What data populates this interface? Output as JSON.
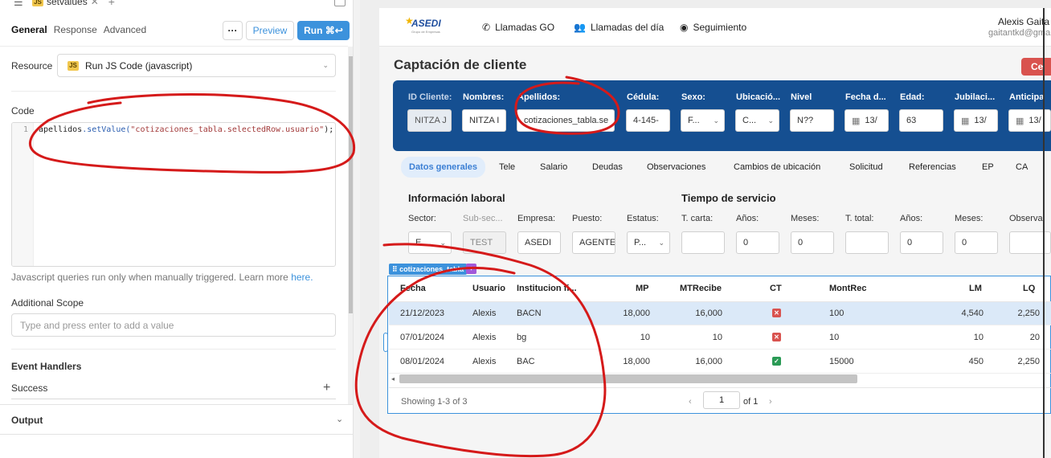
{
  "editor": {
    "query_tab": "setvalues",
    "query_badge": "JS",
    "tabs": [
      "General",
      "Response",
      "Advanced"
    ],
    "more_label": "···",
    "preview_label": "Preview",
    "run_label": "Run ⌘↩",
    "resource_label": "Resource",
    "resource_value": "Run JS Code (javascript)",
    "code_label": "Code",
    "code_line_number": "1",
    "code_obj": "apellidos",
    "code_fn": ".setValue(",
    "code_str": "\"cotizaciones_tabla.selectedRow.usuario\"",
    "code_end": ");",
    "hint_text": "Javascript queries run only when manually triggered. Learn more ",
    "hint_link": "here.",
    "additional_scope_label": "Additional Scope",
    "additional_scope_placeholder": "Type and press enter to add a value",
    "event_handlers_label": "Event Handlers",
    "success_label": "Success",
    "output_label": "Output"
  },
  "app": {
    "logo_text": "ASEDI",
    "logo_sub": "Grupo de Empresas",
    "nav": [
      "Llamadas GO",
      "Llamadas del día",
      "Seguimiento"
    ],
    "user_name": "Alexis Gaita",
    "user_email": "gaitantkd@gmail",
    "page_title": "Captación de cliente",
    "red_button": "Ce",
    "fields": [
      {
        "label": "ID Cliente:",
        "value": "NITZA J"
      },
      {
        "label": "Nombres:",
        "value": "NITZA I"
      },
      {
        "label": "Apellidos:",
        "value": "cotizaciones_tabla.se"
      },
      {
        "label": "Cédula:",
        "value": "4-145-"
      },
      {
        "label": "Sexo:",
        "value": "F..."
      },
      {
        "label": "Ubicació...",
        "value": "C..."
      },
      {
        "label": "Nivel",
        "value": "N??"
      },
      {
        "label": "Fecha d...",
        "value": "13/"
      },
      {
        "label": "Edad:",
        "value": "63"
      },
      {
        "label": "Jubilaci...",
        "value": "13/"
      },
      {
        "label": "Anticipa",
        "value": "13/"
      }
    ],
    "tabs": [
      "Datos generales",
      "Tele",
      "Salario",
      "Deudas",
      "Observaciones",
      "Cambios de ubicación",
      "Solicitud",
      "Referencias",
      "EP",
      "CA"
    ],
    "info_laboral_title": "Información laboral",
    "tiempo_servicio_title": "Tiempo de servicio",
    "labor_fields": [
      {
        "label": "Sector:",
        "value": "E ..."
      },
      {
        "label": "Sub-sec...",
        "value": "TEST"
      },
      {
        "label": "Empresa:",
        "value": "ASEDI"
      },
      {
        "label": "Puesto:",
        "value": "AGENTE"
      },
      {
        "label": "Estatus:",
        "value": "P..."
      },
      {
        "label": "T. carta:",
        "value": ""
      },
      {
        "label": "Años:",
        "value": "0"
      },
      {
        "label": "Meses:",
        "value": "0"
      },
      {
        "label": "T. total:",
        "value": ""
      },
      {
        "label": "Años:",
        "value": "0"
      },
      {
        "label": "Meses:",
        "value": "0"
      },
      {
        "label": "Observa",
        "value": ""
      }
    ],
    "table_tag": "cotizaciones_tabla",
    "table": {
      "columns": [
        "Fecha",
        "Usuario",
        "Institucion fi...",
        "MP",
        "MTRecibe",
        "CT",
        "MontRec",
        "LM",
        "LQ"
      ],
      "rows": [
        {
          "fecha": "21/12/2023",
          "usuario": "Alexis",
          "inst": "BACN",
          "mp": "18,000",
          "mtr": "16,000",
          "ct": false,
          "montrec": "100",
          "lm": "4,540",
          "lq": "2,250"
        },
        {
          "fecha": "07/01/2024",
          "usuario": "Alexis",
          "inst": "bg",
          "mp": "10",
          "mtr": "10",
          "ct": false,
          "montrec": "10",
          "lm": "10",
          "lq": "20"
        },
        {
          "fecha": "08/01/2024",
          "usuario": "Alexis",
          "inst": "BAC",
          "mp": "18,000",
          "mtr": "16,000",
          "ct": true,
          "montrec": "15000",
          "lm": "450",
          "lq": "2,250"
        }
      ],
      "showing": "Showing 1-3 of 3",
      "page": "1",
      "of_pages": "of 1"
    }
  },
  "colors": {
    "accent": "#3c92dc",
    "panel_blue": "#154f91",
    "annotation_red": "#d51a1a"
  }
}
